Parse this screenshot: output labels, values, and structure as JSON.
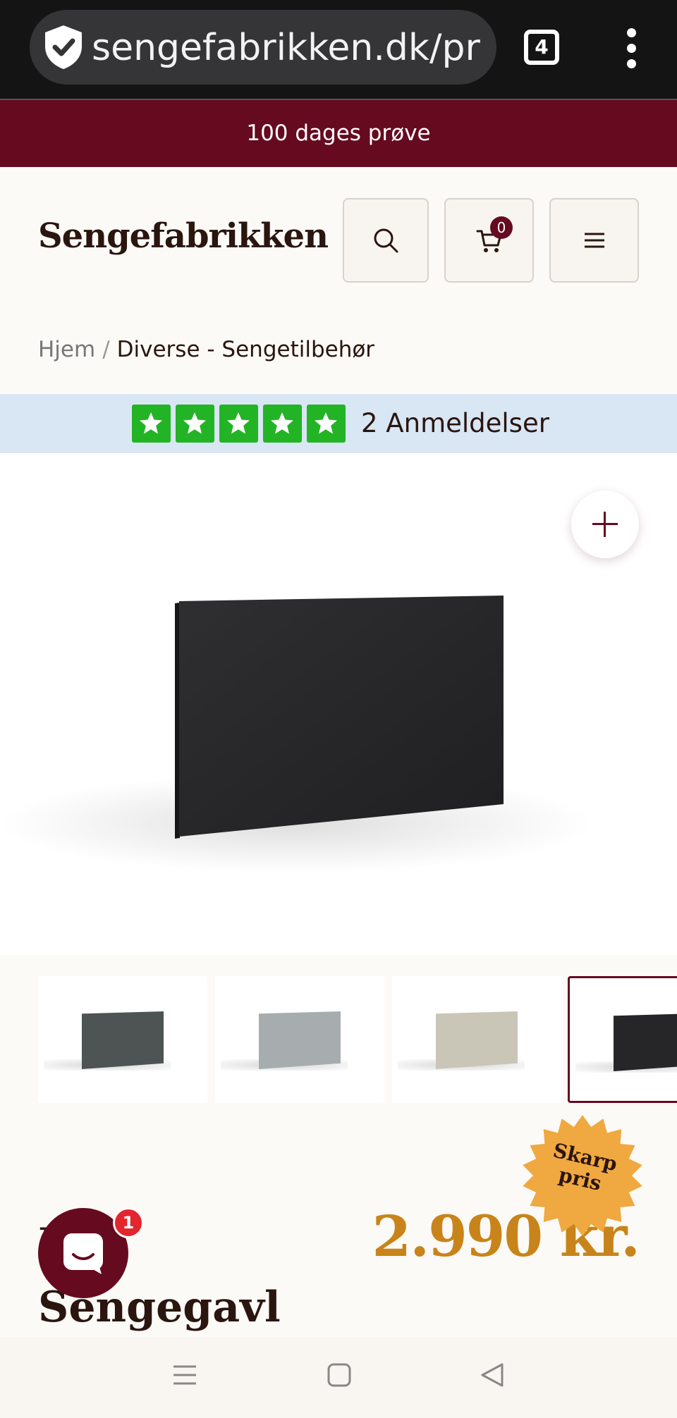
{
  "browser": {
    "url": "sengefabrikken.dk/pr",
    "tab_count": "4",
    "icons": [
      "shield-check-icon",
      "tabs-icon",
      "more-vertical-icon"
    ]
  },
  "promo": {
    "text": "100 dages prøve"
  },
  "header": {
    "logo": "Sengefabrikken",
    "cart_count": "0",
    "icons": [
      "search-icon",
      "cart-icon",
      "hamburger-icon"
    ]
  },
  "breadcrumb": {
    "home": "Hjem",
    "separator": "/",
    "current": "Diverse - Sengetilbehør"
  },
  "reviews": {
    "rating": 5,
    "max_rating": 5,
    "count_label": "2 Anmeldelser"
  },
  "gallery": {
    "main_color": "#262628",
    "thumbnails": [
      {
        "color": "#4d5453",
        "selected": false
      },
      {
        "color": "#a7acae",
        "selected": false
      },
      {
        "color": "#c9c6b8",
        "selected": false
      },
      {
        "color": "#262628",
        "selected": true
      }
    ]
  },
  "badge": {
    "line1": "Skarp",
    "line2": "pris"
  },
  "product": {
    "title": "Lux Sengegavl",
    "price": "2.990 kr."
  },
  "chat": {
    "unread": "1"
  },
  "colors": {
    "brand": "#660a20",
    "price": "#c8841a",
    "badge": "#f0a840",
    "review_green": "#22b425",
    "review_bg": "#d9e6f4"
  },
  "android_nav": [
    "recents-icon",
    "home-icon",
    "back-icon"
  ]
}
